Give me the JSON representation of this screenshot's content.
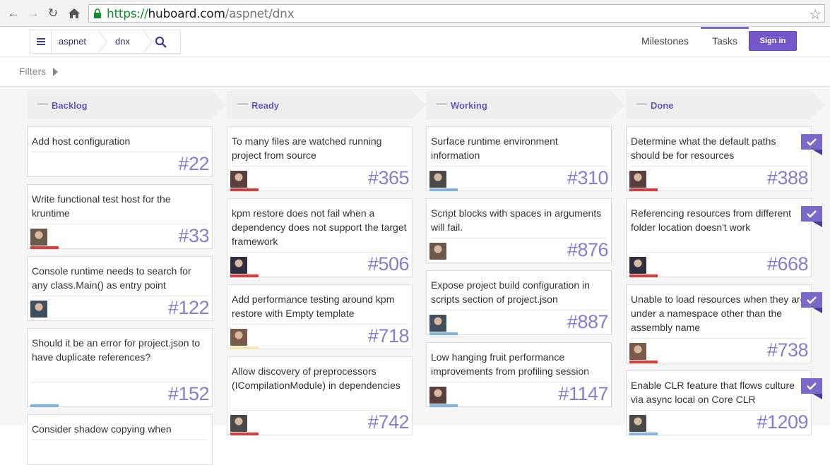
{
  "browser": {
    "url_scheme": "https://",
    "url_host": "huboard.com",
    "url_path": "/aspnet/dnx"
  },
  "header": {
    "breadcrumbs": [
      "aspnet",
      "dnx"
    ],
    "nav": [
      "Milestones",
      "Tasks"
    ],
    "active_nav": "Tasks",
    "signin_label": "Sign in"
  },
  "filters": {
    "label": "Filters"
  },
  "colors": {
    "accent": "#7b68c9",
    "number": "#8a7bd0",
    "bar_red": "#e03a3a",
    "bar_blue": "#7fb2e5",
    "bar_yellow": "#f7e7a8"
  },
  "columns": [
    {
      "title": "Backlog",
      "cards": [
        {
          "title": "Add host configuration",
          "number": "#22",
          "avatar": false,
          "bar": "none",
          "done": false
        },
        {
          "title": "Write functional test host for the kruntime",
          "number": "#33",
          "avatar": true,
          "bar": "red",
          "done": false
        },
        {
          "title": "Console runtime needs to search for any class.Main() as entry point",
          "number": "#122",
          "avatar": true,
          "bar": "none",
          "done": false
        },
        {
          "title": "Should it be an error for project.json to have duplicate references?",
          "number": "#152",
          "avatar": false,
          "bar": "blue",
          "done": false
        },
        {
          "title": "Consider shadow copying when",
          "number": "",
          "avatar": false,
          "bar": "none",
          "done": false
        }
      ]
    },
    {
      "title": "Ready",
      "cards": [
        {
          "title": "To many files are watched running project from source",
          "number": "#365",
          "avatar": true,
          "bar": "red",
          "done": false
        },
        {
          "title": "kpm restore does not fail when a dependency does not support the target framework",
          "number": "#506",
          "avatar": true,
          "bar": "red",
          "done": false
        },
        {
          "title": "Add performance testing around kpm restore with Empty template",
          "number": "#718",
          "avatar": true,
          "bar": "yellow",
          "done": false
        },
        {
          "title": "Allow discovery of preprocessors (ICompilationModule) in dependencies",
          "number": "#742",
          "avatar": true,
          "bar": "red",
          "done": false
        }
      ]
    },
    {
      "title": "Working",
      "cards": [
        {
          "title": "Surface runtime environment information",
          "number": "#310",
          "avatar": true,
          "bar": "blue",
          "done": false
        },
        {
          "title": "Script blocks with spaces in arguments will fail.",
          "number": "#876",
          "avatar": true,
          "bar": "none",
          "done": false
        },
        {
          "title": "Expose project build configuration in scripts section of project.json",
          "number": "#887",
          "avatar": true,
          "bar": "blue",
          "done": false
        },
        {
          "title": "Low hanging fruit performance improvements from profiling session",
          "number": "#1147",
          "avatar": true,
          "bar": "blue",
          "done": false
        }
      ]
    },
    {
      "title": "Done",
      "cards": [
        {
          "title": "Determine what the default paths should be for resources",
          "number": "#388",
          "avatar": true,
          "bar": "red",
          "done": true
        },
        {
          "title": "Referencing resources from different folder location doesn't work",
          "number": "#668",
          "avatar": true,
          "bar": "red",
          "done": true
        },
        {
          "title": "Unable to load resources when they are under a namespace other than the assembly name",
          "number": "#738",
          "avatar": true,
          "bar": "red",
          "done": true
        },
        {
          "title": "Enable CLR feature that flows culture via async local on Core CLR",
          "number": "#1209",
          "avatar": true,
          "bar": "blue",
          "done": true
        }
      ]
    }
  ]
}
